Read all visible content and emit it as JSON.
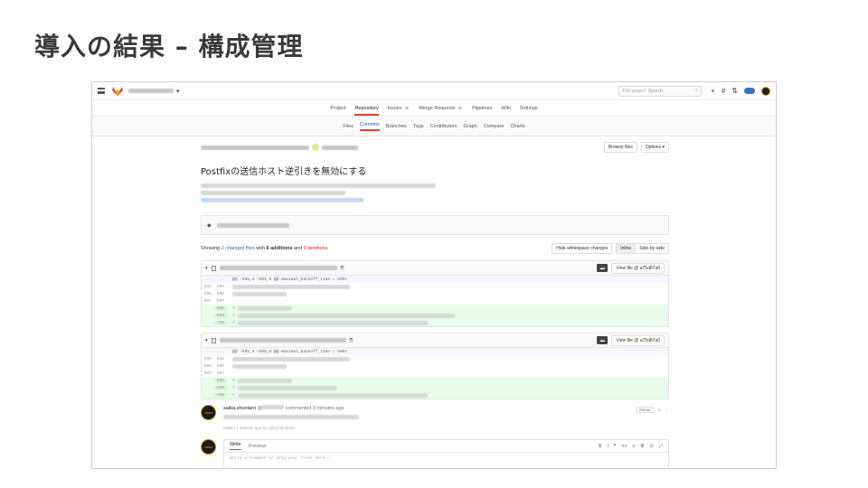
{
  "slide": {
    "title": "導入の結果 – 構成管理"
  },
  "topbar": {
    "search_scope": "This project",
    "search_placeholder": "Search",
    "plus": "+",
    "hash": "#",
    "merge": "⇅"
  },
  "nav_primary": [
    {
      "label": "Project",
      "active": false
    },
    {
      "label": "Repository",
      "active": true
    },
    {
      "label": "Issues",
      "badge": "0",
      "active": false
    },
    {
      "label": "Merge Requests",
      "badge": "0",
      "active": false
    },
    {
      "label": "Pipelines",
      "active": false
    },
    {
      "label": "Wiki",
      "active": false
    },
    {
      "label": "Settings",
      "active": false
    }
  ],
  "nav_secondary": [
    {
      "label": "Files",
      "active": false
    },
    {
      "label": "Commits",
      "active": true
    },
    {
      "label": "Branches",
      "active": false
    },
    {
      "label": "Tags",
      "active": false
    },
    {
      "label": "Contributors",
      "active": false
    },
    {
      "label": "Graph",
      "active": false
    },
    {
      "label": "Compare",
      "active": false
    },
    {
      "label": "Charts",
      "active": false
    }
  ],
  "commit": {
    "browse_files": "Browse files",
    "options": "Options ▾",
    "title": "Postfixの送信ホスト逆引きを無効にする"
  },
  "stats": {
    "showing": "Showing",
    "changed_files": "2 changed files",
    "with": "with",
    "additions": "6 additions",
    "and": "and",
    "deletions": "0 deletions",
    "hide_whitespace": "Hide whitespace changes",
    "inline": "Inline",
    "side_by_side": "Side-by-side"
  },
  "diffs": [
    {
      "view_file": "View file @ a75d87a0",
      "hunk": "@@ -695,3 +695,6 @@ maximal_backoff_time = 600s",
      "context_lines": [
        [
          "695",
          "695"
        ],
        [
          "696",
          "696"
        ],
        [
          "697",
          "697"
        ]
      ],
      "added_lines": [
        "698",
        "699",
        "700"
      ]
    },
    {
      "view_file": "View file @ a75d87a0",
      "hunk": "@@ -695,3 +695,6 @@ maximal_backoff_time = 600s",
      "context_lines": [
        [
          "695",
          "695"
        ],
        [
          "696",
          "696"
        ],
        [
          "697",
          "697"
        ]
      ],
      "added_lines": [
        "698",
        "699",
        "700"
      ]
    }
  ],
  "comment": {
    "avatar": "OPEN",
    "author": "saiba,shuntaro",
    "at": "@",
    "action": "commented 3 minutes ago",
    "role": "Owner",
    "edited": "Edited 4 minutes ago by saiba,shuntaro"
  },
  "editor": {
    "avatar": "OPEN",
    "tab_write": "Write",
    "tab_preview": "Preview",
    "tools": [
      "B",
      "I",
      "❞",
      "<>",
      "≡",
      "≣",
      "☑",
      "⤢"
    ],
    "placeholder": "Write a comment or drag your files here..."
  }
}
